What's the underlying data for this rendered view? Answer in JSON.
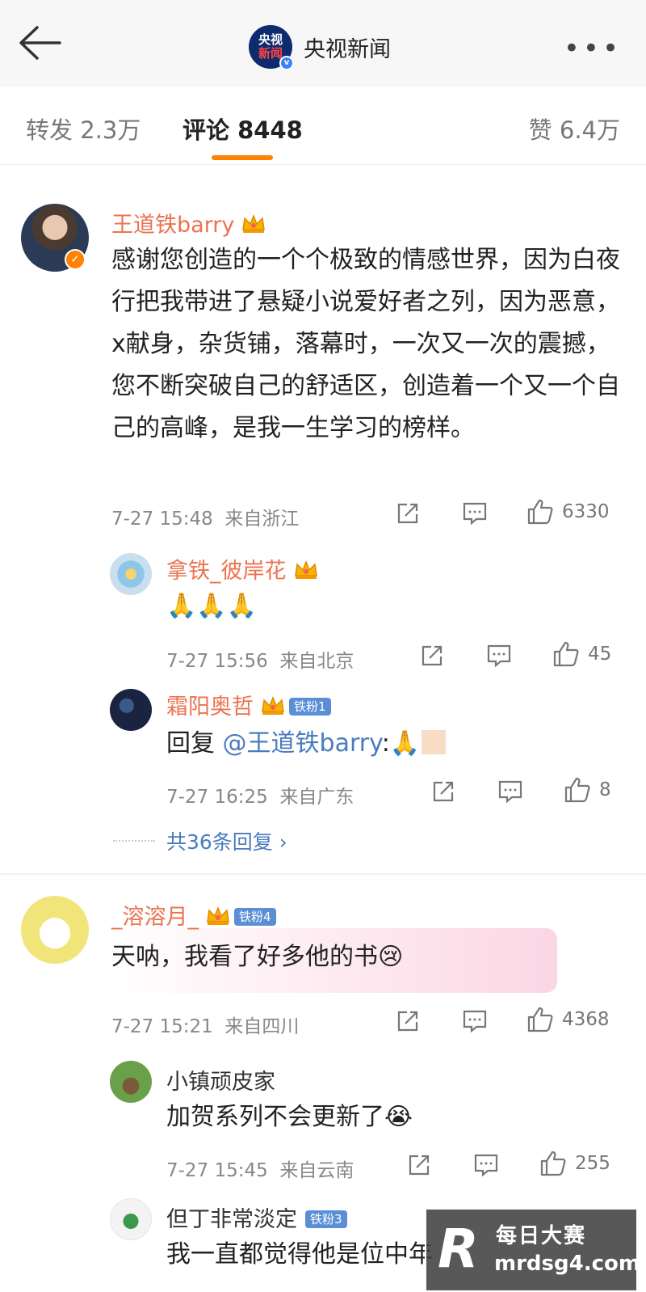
{
  "header": {
    "account_name": "央视新闻",
    "logo_text_top": "央视",
    "logo_text_bottom": "新闻",
    "verified_mark": "v",
    "more_label": "•••"
  },
  "tabs": {
    "repost": "转发 2.3万",
    "comment": "评论 8448",
    "like": "赞 6.4万"
  },
  "comments": [
    {
      "user": "王道铁barry",
      "text": "感谢您创造的一个个极致的情感世界，因为白夜行把我带进了悬疑小说爱好者之列，因为恶意，x献身，杂货铺，落幕时，一次又一次的震撼，您不断突破自己的舒适区，创造着一个又一个自己的高峰，是我一生学习的榜样。",
      "time": "7-27 15:48",
      "location": "来自浙江",
      "likes": "6330",
      "replies": [
        {
          "user": "拿铁_彼岸花",
          "text": "🙏🙏🙏",
          "time": "7-27 15:56",
          "location": "来自北京",
          "likes": "45"
        },
        {
          "user": "霜阳奥哲",
          "fan_badge": "铁粉1",
          "text_prefix": "回复 ",
          "mention": "@王道铁barry",
          "text_suffix": ":🙏",
          "time": "7-27 16:25",
          "location": "来自广东",
          "likes": "8"
        }
      ],
      "more_replies": "共36条回复 ›"
    },
    {
      "user": "_溶溶月_",
      "fan_badge": "铁粉4",
      "text": "天呐，我看了好多他的书😢",
      "time": "7-27 15:21",
      "location": "来自四川",
      "likes": "4368",
      "replies": [
        {
          "user": "小镇顽皮家",
          "text": "加贺系列不会更新了😭",
          "time": "7-27 15:45",
          "location": "来自云南",
          "likes": "255"
        },
        {
          "user": "但丁非常淡定",
          "fan_badge": "铁粉3",
          "text": "我一直都觉得他是位中年"
        }
      ]
    }
  ],
  "watermark": {
    "title": "每日大赛",
    "url": "mrdsg4.com",
    "logo_letter": "R"
  },
  "colors": {
    "accent": "#ff8200",
    "username": "#eb7350",
    "link": "#4a7bbf"
  }
}
